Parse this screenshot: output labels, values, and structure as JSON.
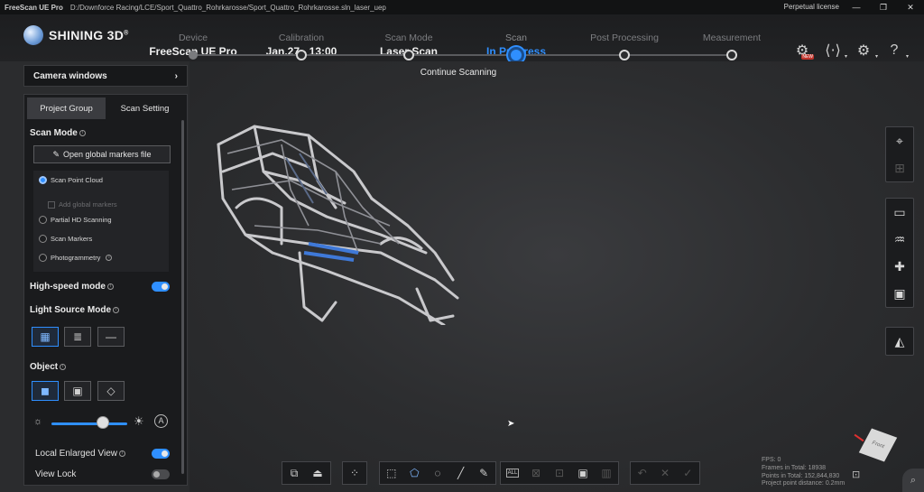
{
  "titlebar": {
    "app": "FreeScan UE Pro",
    "path": "D:/Downforce Racing/LCE/Sport_Quattro_Rohrkarosse/Sport_Quattro_Rohrkarosse.sln_laser_uep",
    "license": "Perpetual license",
    "minimize": "—",
    "restore": "❐",
    "close": "✕"
  },
  "logo": {
    "text": "SHINING 3D",
    "mark": "®"
  },
  "steps": [
    {
      "title": "Device",
      "value": "FreeScan UE Pro"
    },
    {
      "title": "Calibration",
      "value": "Jan.27 - 13:00"
    },
    {
      "title": "Scan Mode",
      "value": "Laser Scan"
    },
    {
      "title": "Scan",
      "value": "In Progress"
    },
    {
      "title": "Post Processing",
      "value": "-"
    },
    {
      "title": "Measurement",
      "value": "-"
    }
  ],
  "continue_label": "Continue Scanning",
  "header_icons": {
    "new_badge": "NEW"
  },
  "camera_windows": "Camera windows",
  "panel": {
    "tabs": [
      "Project Group",
      "Scan Setting"
    ],
    "scan_mode_title": "Scan Mode",
    "open_markers": "Open global markers file",
    "modes": [
      "Scan Point Cloud",
      "Add global markers",
      "Partial HD Scanning",
      "Scan Markers",
      "Photogrammetry"
    ],
    "high_speed": "High-speed mode",
    "light_source": "Light Source Mode",
    "object": "Object",
    "auto_label": "A",
    "local_enlarged": "Local Enlarged View",
    "view_lock": "View Lock"
  },
  "bottom_toolbar": {
    "all_label": "ALL"
  },
  "stats": {
    "fps": "FPS:  0",
    "frames": "Frames in Total:  18938",
    "points": "Points in Total:  152,844,830",
    "distance": "Project point distance:  0.2mm"
  },
  "viewcube": {
    "label": "Front"
  },
  "colors": {
    "accent": "#2f8fff",
    "background": "#2b2c2e",
    "panel": "#1a1b1d"
  }
}
